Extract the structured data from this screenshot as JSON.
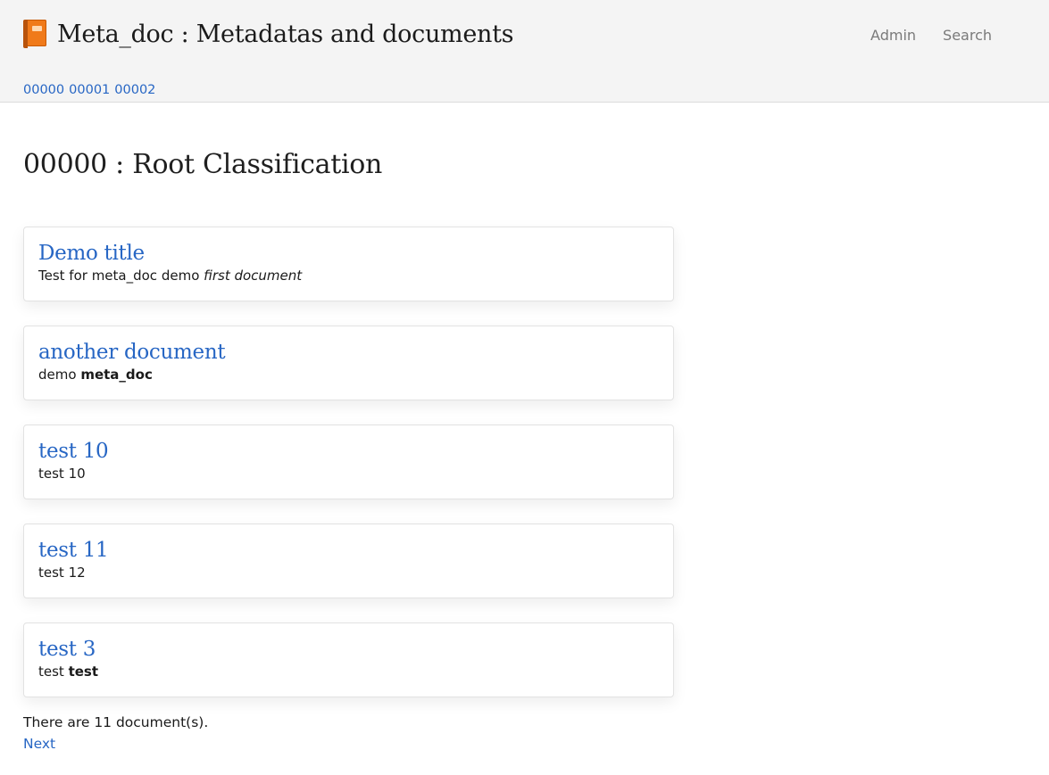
{
  "header": {
    "title": "Meta_doc : Metadatas and documents",
    "brand_icon": "orange-book-icon",
    "nav": {
      "admin": "Admin",
      "search": "Search"
    },
    "breadcrumb": [
      "00000",
      "00001",
      "00002"
    ]
  },
  "main": {
    "page_title": "00000 : Root Classification",
    "documents": [
      {
        "title": "Demo title",
        "desc_plain": "Test for meta_doc demo ",
        "desc_em": "first document"
      },
      {
        "title": "another document",
        "desc_plain": "demo ",
        "desc_strong": "meta_doc"
      },
      {
        "title": "test 10",
        "desc_plain": "test 10"
      },
      {
        "title": "test 11",
        "desc_plain": "test 12"
      },
      {
        "title": "test 3",
        "desc_plain": "test ",
        "desc_strong": "test"
      }
    ],
    "count_text": "There are 11 document(s).",
    "next_label": "Next"
  },
  "colors": {
    "link": "#2766c4",
    "header_bg": "#f4f4f4",
    "nav": "#7a7a7a"
  }
}
